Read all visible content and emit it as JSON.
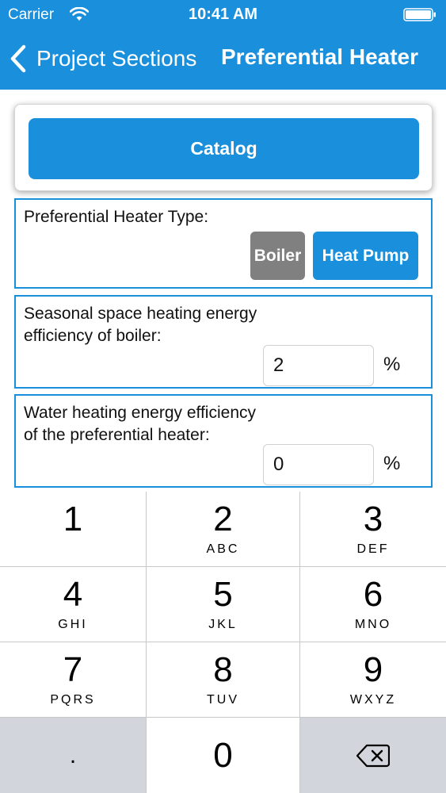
{
  "status_bar": {
    "carrier": "Carrier",
    "time": "10:41 AM"
  },
  "nav": {
    "back_label": "Project Sections",
    "title": "Preferential Heater"
  },
  "catalog": {
    "label": "Catalog"
  },
  "heater_type": {
    "label": "Preferential Heater Type:",
    "options": [
      "Boiler",
      "Heat Pump"
    ],
    "selected": "Heat Pump"
  },
  "space_heating": {
    "label_line1": "Seasonal space heating energy",
    "label_line2": "efficiency of boiler:",
    "value": "2",
    "unit": "%"
  },
  "water_heating": {
    "label_line1": "Water heating energy efficiency",
    "label_line2": "of the preferential heater:",
    "value": "0",
    "unit": "%"
  },
  "keypad": {
    "keys": [
      {
        "digit": "1",
        "letters": ""
      },
      {
        "digit": "2",
        "letters": "ABC"
      },
      {
        "digit": "3",
        "letters": "DEF"
      },
      {
        "digit": "4",
        "letters": "GHI"
      },
      {
        "digit": "5",
        "letters": "JKL"
      },
      {
        "digit": "6",
        "letters": "MNO"
      },
      {
        "digit": "7",
        "letters": "PQRS"
      },
      {
        "digit": "8",
        "letters": "TUV"
      },
      {
        "digit": "9",
        "letters": "WXYZ"
      }
    ],
    "decimal": ".",
    "zero": "0"
  },
  "colors": {
    "accent": "#1a8fdc",
    "inactive_button": "#808080"
  }
}
